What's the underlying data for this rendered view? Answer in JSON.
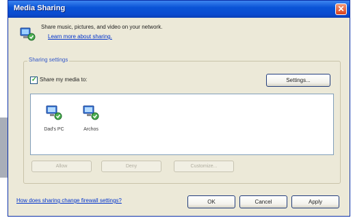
{
  "window": {
    "title": "Media Sharing",
    "close_glyph": "✕"
  },
  "intro": {
    "text": "Share music, pictures, and video on your network.",
    "link": "Learn more about sharing.",
    "icon": "media-sharing-icon"
  },
  "sharing_settings": {
    "group_label": "Sharing settings",
    "share_checkbox_label": "Share my media to:",
    "share_checked": true,
    "settings_button": "Settings..."
  },
  "devices": [
    {
      "label": "Dad's PC",
      "icon": "networked-computer-icon",
      "status": "shared"
    },
    {
      "label": "Archos",
      "icon": "networked-computer-icon",
      "status": "shared"
    }
  ],
  "device_actions": {
    "allow": "Allow",
    "deny": "Deny",
    "customize": "Customize..."
  },
  "footer": {
    "firewall_link": "How does sharing change firewall settings?",
    "ok": "OK",
    "cancel": "Cancel",
    "apply": "Apply"
  },
  "colors": {
    "title_bar": "#0a54d6",
    "dialog_bg": "#ece9d8",
    "link": "#0033cc",
    "check": "#21a121"
  }
}
